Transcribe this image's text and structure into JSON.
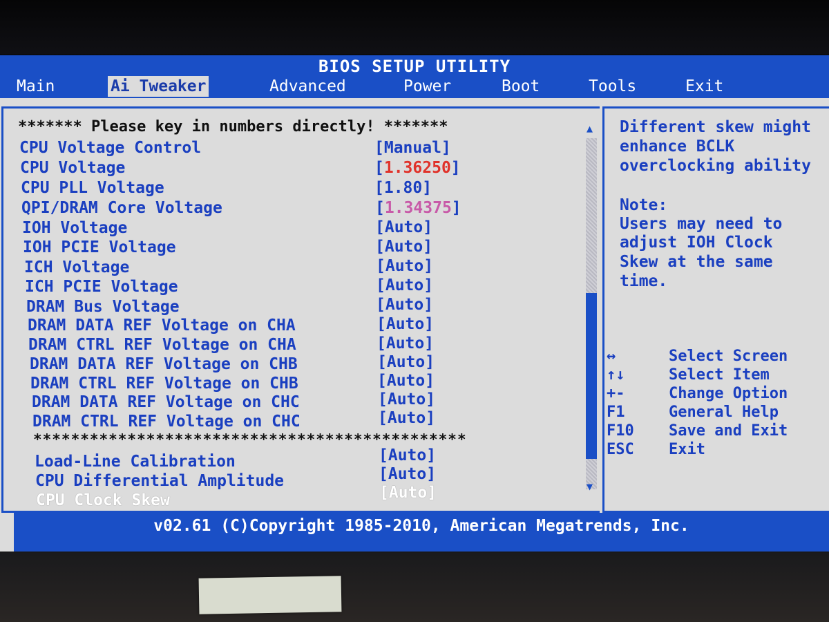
{
  "title": "BIOS SETUP UTILITY",
  "menu": [
    {
      "label": "Main",
      "active": false
    },
    {
      "label": "Ai Tweaker",
      "active": true
    },
    {
      "label": "Advanced",
      "active": false
    },
    {
      "label": "Power",
      "active": false
    },
    {
      "label": "Boot",
      "active": false
    },
    {
      "label": "Tools",
      "active": false
    },
    {
      "label": "Exit",
      "active": false
    }
  ],
  "settings": {
    "heading": "******* Please key in numbers directly! *******",
    "separator": "**********************************************",
    "items": [
      {
        "label": "CPU Voltage Control",
        "value": "[Manual]"
      },
      {
        "label": "CPU Voltage",
        "value_open": "[",
        "value_num": "1.36250",
        "value_close": "]",
        "num_color": "#e0322a"
      },
      {
        "label": "CPU PLL Voltage",
        "value": "[1.80]"
      },
      {
        "label": "QPI/DRAM Core Voltage",
        "value_open": "[",
        "value_num": "1.34375",
        "value_close": "]",
        "num_color": "#c85aa8"
      },
      {
        "label": "IOH Voltage",
        "value": "[Auto]"
      },
      {
        "label": "IOH PCIE Voltage",
        "value": "[Auto]"
      },
      {
        "label": "ICH Voltage",
        "value": "[Auto]"
      },
      {
        "label": "ICH PCIE Voltage",
        "value": "[Auto]"
      },
      {
        "label": "DRAM Bus Voltage",
        "value": "[Auto]"
      },
      {
        "label": "DRAM DATA REF Voltage on CHA",
        "value": "[Auto]"
      },
      {
        "label": "DRAM CTRL REF Voltage on CHA",
        "value": "[Auto]"
      },
      {
        "label": "DRAM DATA REF Voltage on CHB",
        "value": "[Auto]"
      },
      {
        "label": "DRAM CTRL REF Voltage on CHB",
        "value": "[Auto]"
      },
      {
        "label": "DRAM DATA REF Voltage on CHC",
        "value": "[Auto]"
      },
      {
        "label": "DRAM CTRL REF Voltage on CHC",
        "value": "[Auto]"
      }
    ],
    "lower_items": [
      {
        "label": "Load-Line Calibration",
        "value": "[Auto]",
        "selected": false
      },
      {
        "label": "CPU Differential Amplitude",
        "value": "[Auto]",
        "selected": false
      },
      {
        "label": "CPU Clock Skew",
        "value": "[Auto]",
        "selected": true
      }
    ]
  },
  "help": {
    "lines": [
      "Different skew might",
      "enhance BCLK",
      "overclocking ability",
      "",
      "Note:",
      "Users may need to",
      "adjust IOH Clock",
      "Skew at the same",
      "time."
    ]
  },
  "keys": [
    {
      "key": "↔",
      "desc": "Select Screen"
    },
    {
      "key": "↑↓",
      "desc": "Select Item"
    },
    {
      "key": "+-",
      "desc": "Change Option"
    },
    {
      "key": "F1",
      "desc": "General Help"
    },
    {
      "key": "F10",
      "desc": "Save and Exit"
    },
    {
      "key": "ESC",
      "desc": "Exit"
    }
  ],
  "footer": "v02.61 (C)Copyright 1985-2010, American Megatrends, Inc.",
  "scroll": {
    "up_arrow": "▲",
    "down_arrow": "▼"
  },
  "colors": {
    "bios_blue": "#1a4fc6",
    "screen_bg": "#dcdcdc",
    "highlight_red": "#e0322a",
    "highlight_pink": "#c85aa8"
  }
}
